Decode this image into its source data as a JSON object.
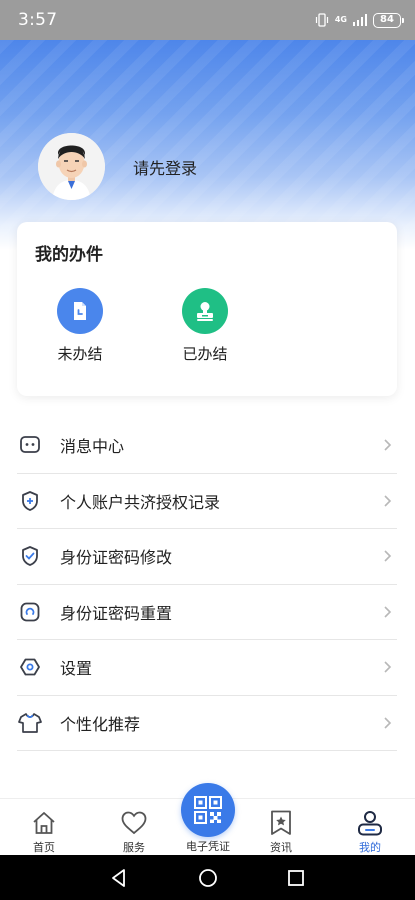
{
  "status_bar": {
    "time": "3:57",
    "network": "4G",
    "battery": "84"
  },
  "profile": {
    "login_prompt": "请先登录"
  },
  "card": {
    "title": "我的办件",
    "items": [
      {
        "label": "未办结",
        "icon": "pending-document-icon",
        "color": "#4a86ec"
      },
      {
        "label": "已办结",
        "icon": "completed-stamp-icon",
        "color": "#1fbf85"
      }
    ]
  },
  "menu": [
    {
      "label": "消息中心",
      "icon": "message-icon"
    },
    {
      "label": "个人账户共济授权记录",
      "icon": "shield-plus-icon"
    },
    {
      "label": "身份证密码修改",
      "icon": "shield-check-icon"
    },
    {
      "label": "身份证密码重置",
      "icon": "reset-icon"
    },
    {
      "label": "设置",
      "icon": "settings-icon"
    },
    {
      "label": "个性化推荐",
      "icon": "tshirt-icon"
    }
  ],
  "tabbar": {
    "home": "首页",
    "service": "服务",
    "qr": "电子凭证",
    "news": "资讯",
    "mine": "我的",
    "active": "mine",
    "active_color": "#2f6ad9"
  }
}
